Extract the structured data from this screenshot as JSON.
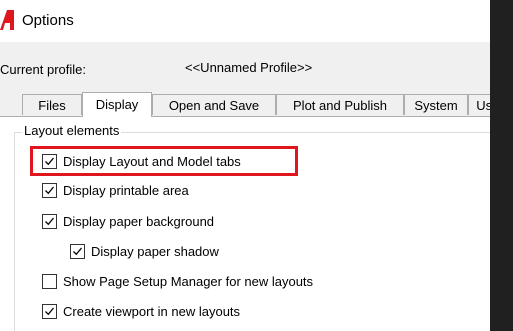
{
  "window": {
    "title": "Options",
    "accent_color": "#e0161e"
  },
  "profile": {
    "label": "Current profile:",
    "value": "<<Unnamed Profile>>"
  },
  "tabs": [
    {
      "label": "Files",
      "active": false
    },
    {
      "label": "Display",
      "active": true
    },
    {
      "label": "Open and Save",
      "active": false
    },
    {
      "label": "Plot and Publish",
      "active": false
    },
    {
      "label": "System",
      "active": false
    },
    {
      "label": "User",
      "active": false
    }
  ],
  "layout_elements": {
    "legend": "Layout elements",
    "options": [
      {
        "label": "Display Layout and Model tabs",
        "checked": true,
        "highlighted": true
      },
      {
        "label": "Display printable area",
        "checked": true
      },
      {
        "label": "Display paper background",
        "checked": true
      },
      {
        "label": "Display paper shadow",
        "checked": true
      },
      {
        "label": "Show Page Setup Manager for new layouts",
        "checked": false
      },
      {
        "label": "Create viewport in new layouts",
        "checked": true
      }
    ]
  }
}
